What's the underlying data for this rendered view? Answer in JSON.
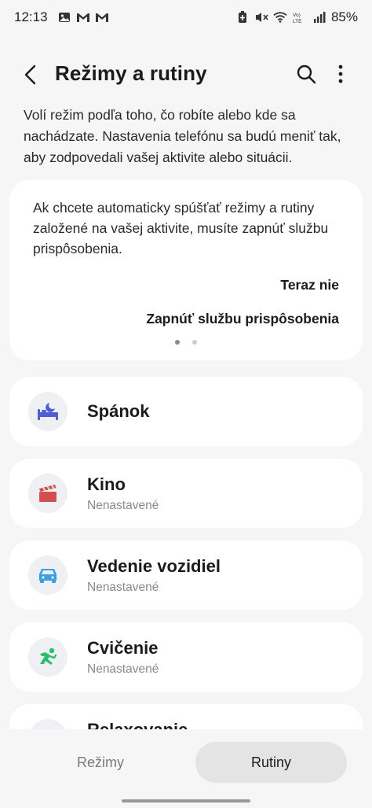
{
  "status_bar": {
    "time": "12:13",
    "battery": "85%",
    "left_icons": [
      "gallery-icon",
      "gmail-icon",
      "gmail-icon"
    ],
    "right_icons": [
      "battery-saver-icon",
      "mute-icon",
      "wifi-icon",
      "volte-icon",
      "signal-icon"
    ]
  },
  "app_bar": {
    "title": "Režimy a rutiny"
  },
  "description": "Volí režim podľa toho, čo robíte alebo kde sa nachádzate. Nastavenia telefónu sa budú meniť tak, aby zodpovedali vašej aktivite alebo situácii.",
  "info_card": {
    "text": "Ak chcete automaticky spúšťať režimy a rutiny založené na vašej aktivite, musíte zapnúť službu prispôsobenia.",
    "dismiss_label": "Teraz nie",
    "enable_label": "Zapnúť službu prispôsobenia",
    "page_index": 1,
    "page_count": 2
  },
  "modes": [
    {
      "title": "Spánok",
      "subtitle": "",
      "icon": "bed-icon",
      "color": "#4c5fcf"
    },
    {
      "title": "Kino",
      "subtitle": "Nenastavené",
      "icon": "clapperboard-icon",
      "color": "#d1504f"
    },
    {
      "title": "Vedenie vozidiel",
      "subtitle": "Nenastavené",
      "icon": "car-icon",
      "color": "#3aa0e6"
    },
    {
      "title": "Cvičenie",
      "subtitle": "Nenastavené",
      "icon": "running-icon",
      "color": "#2ebd6b"
    },
    {
      "title": "Relaxovanie",
      "subtitle": "",
      "icon": "relax-icon",
      "color": "#7b68d8"
    }
  ],
  "bottom_nav": {
    "tabs": [
      {
        "label": "Režimy",
        "selected": false
      },
      {
        "label": "Rutiny",
        "selected": true
      }
    ]
  }
}
